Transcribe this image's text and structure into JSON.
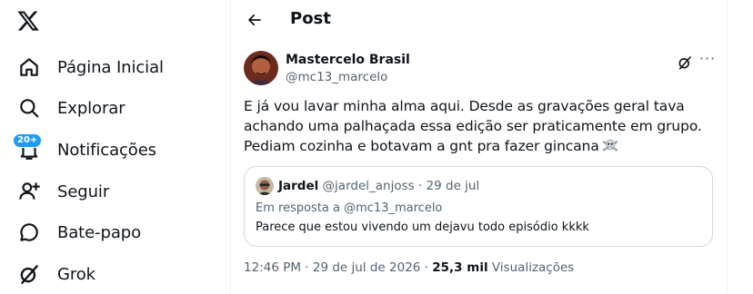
{
  "nav": {
    "logo_icon": "x-logo-icon",
    "items": [
      {
        "label": "Página Inicial",
        "icon": "home-icon"
      },
      {
        "label": "Explorar",
        "icon": "search-icon"
      },
      {
        "label": "Notificações",
        "icon": "bell-icon",
        "badge": "20+"
      },
      {
        "label": "Seguir",
        "icon": "follow-icon"
      },
      {
        "label": "Bate-papo",
        "icon": "chat-icon"
      },
      {
        "label": "Grok",
        "icon": "grok-icon"
      }
    ]
  },
  "header": {
    "title": "Post",
    "back_icon": "arrow-left-icon"
  },
  "post": {
    "author_name": "Mastercelo Brasil",
    "author_handle": "@mc13_marcelo",
    "text": "E já vou lavar minha alma aqui. Desde as gravações geral tava achando uma palhaçada essa edição ser praticamente em grupo. Pediam cozinha e botavam a gnt pra fazer gincana",
    "emoji": "skull-crossbones-icon",
    "timestamp": "12:46 PM · 29 de jul de 2026",
    "views_sep": " · ",
    "views_count": "25,3 mil",
    "views_label": "Visualizações"
  },
  "quote": {
    "name": "Jardel",
    "handle": "@jardel_anjoss",
    "sep": " · ",
    "date": "29 de jul",
    "reply_prefix": "Em resposta a ",
    "reply_handle": "@mc13_marcelo",
    "text": "Parece que estou vivendo um dejavu todo episódio kkkk"
  },
  "colors": {
    "accent": "#1d9bf0",
    "text": "#0f1419",
    "muted": "#536471",
    "border": "#cfd9de"
  }
}
